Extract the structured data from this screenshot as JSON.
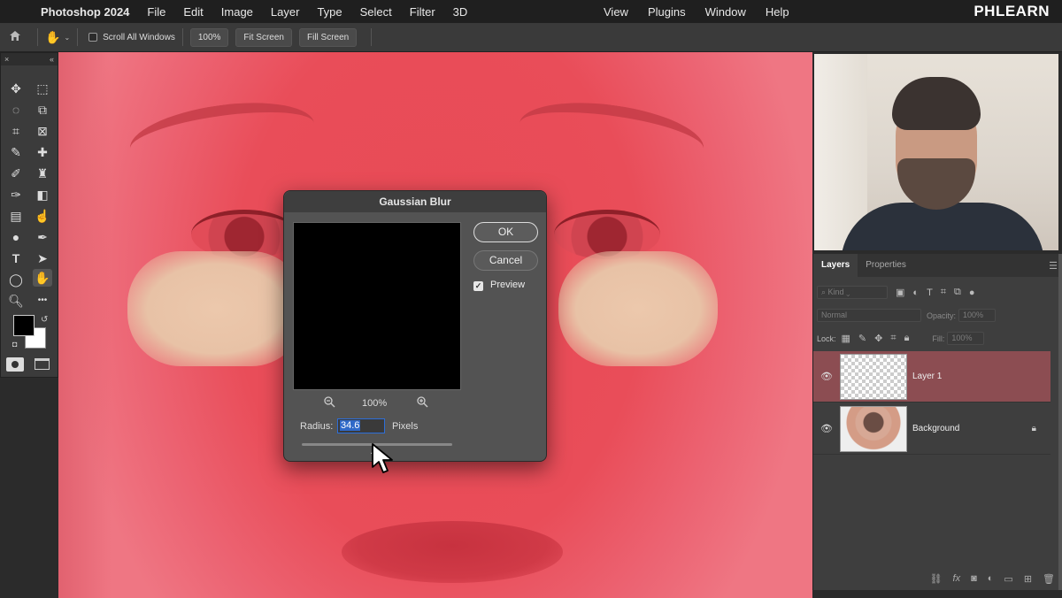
{
  "menubar": {
    "app_name": "Photoshop 2024",
    "items": [
      "File",
      "Edit",
      "Image",
      "Layer",
      "Type",
      "Select",
      "Filter",
      "3D"
    ],
    "right_items": [
      "View",
      "Plugins",
      "Window",
      "Help"
    ],
    "brand": "PHLEARN"
  },
  "options_bar": {
    "scroll_all_windows": "Scroll All Windows",
    "zoom_100": "100%",
    "fit_screen": "Fit Screen",
    "fill_screen": "Fill Screen"
  },
  "tools_panel": {
    "close_glyph": "×",
    "collapse_glyph": "«",
    "tools": [
      {
        "name": "move-tool-icon",
        "glyph": "✥"
      },
      {
        "name": "marquee-tool-icon",
        "glyph": "⬚"
      },
      {
        "name": "lasso-tool-icon",
        "glyph": "◌"
      },
      {
        "name": "object-select-tool-icon",
        "glyph": "⧉"
      },
      {
        "name": "crop-tool-icon",
        "glyph": "⌗"
      },
      {
        "name": "frame-tool-icon",
        "glyph": "⊠"
      },
      {
        "name": "eyedropper-tool-icon",
        "glyph": "✎"
      },
      {
        "name": "healing-brush-tool-icon",
        "glyph": "✚"
      },
      {
        "name": "brush-tool-icon",
        "glyph": "✐"
      },
      {
        "name": "stamp-tool-icon",
        "glyph": "♜"
      },
      {
        "name": "history-brush-tool-icon",
        "glyph": "✑"
      },
      {
        "name": "eraser-tool-icon",
        "glyph": "◧"
      },
      {
        "name": "gradient-tool-icon",
        "glyph": "▤"
      },
      {
        "name": "smudge-tool-icon",
        "glyph": "☝"
      },
      {
        "name": "dodge-tool-icon",
        "glyph": "●"
      },
      {
        "name": "pen-tool-icon",
        "glyph": "✒"
      },
      {
        "name": "type-tool-icon",
        "glyph": "T"
      },
      {
        "name": "path-select-tool-icon",
        "glyph": "➤"
      },
      {
        "name": "ellipse-tool-icon",
        "glyph": "◯"
      },
      {
        "name": "hand-tool-icon",
        "glyph": "✋"
      },
      {
        "name": "zoom-tool-icon",
        "glyph": "🔍︎"
      },
      {
        "name": "more-tools-icon",
        "glyph": "•••"
      }
    ]
  },
  "dialog": {
    "title": "Gaussian Blur",
    "ok": "OK",
    "cancel": "Cancel",
    "preview_label": "Preview",
    "zoom": "100%",
    "radius_label": "Radius:",
    "radius_value": "34.6",
    "units": "Pixels"
  },
  "layers_panel": {
    "tabs": [
      "Layers",
      "Properties"
    ],
    "filter_kind": "Kind",
    "blend_mode": "Normal",
    "opacity_label": "Opacity:",
    "opacity_value": "100%",
    "lock_label": "Lock:",
    "fill_label": "Fill:",
    "fill_value": "100%",
    "layers": [
      {
        "name": "Layer 1",
        "selected": true,
        "visible": true
      },
      {
        "name": "Background",
        "selected": false,
        "visible": true,
        "locked": true
      }
    ]
  },
  "colors": {
    "accent_selected_layer": "#8c4d52",
    "mask_overlay": "#e94d59",
    "input_highlight": "#2f69c8"
  }
}
